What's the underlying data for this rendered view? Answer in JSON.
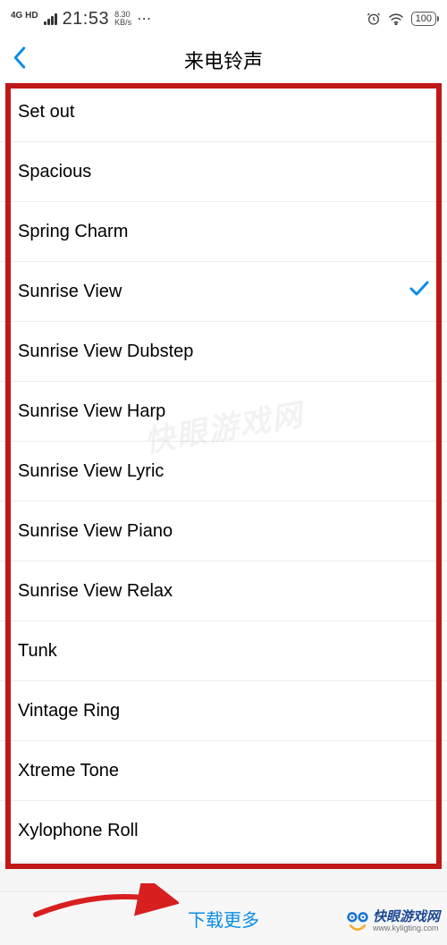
{
  "status_bar": {
    "network_label": "4G HD",
    "time": "21:53",
    "speed_value": "8.30",
    "speed_unit": "KB/s",
    "battery": "100"
  },
  "header": {
    "title": "来电铃声"
  },
  "ringtones": [
    {
      "name": "Set out",
      "selected": false
    },
    {
      "name": "Spacious",
      "selected": false
    },
    {
      "name": "Spring Charm",
      "selected": false
    },
    {
      "name": "Sunrise View",
      "selected": true
    },
    {
      "name": "Sunrise View Dubstep",
      "selected": false
    },
    {
      "name": "Sunrise View Harp",
      "selected": false
    },
    {
      "name": "Sunrise View Lyric",
      "selected": false
    },
    {
      "name": "Sunrise View Piano",
      "selected": false
    },
    {
      "name": "Sunrise View Relax",
      "selected": false
    },
    {
      "name": "Tunk",
      "selected": false
    },
    {
      "name": "Vintage Ring",
      "selected": false
    },
    {
      "name": "Xtreme Tone",
      "selected": false
    },
    {
      "name": "Xylophone Roll",
      "selected": false
    }
  ],
  "footer": {
    "download_more": "下载更多"
  },
  "watermark": {
    "brand": "快眼游戏网",
    "url": "www.kyligting.com"
  },
  "colors": {
    "accent": "#0b8ee8",
    "annotation": "#c01818"
  }
}
